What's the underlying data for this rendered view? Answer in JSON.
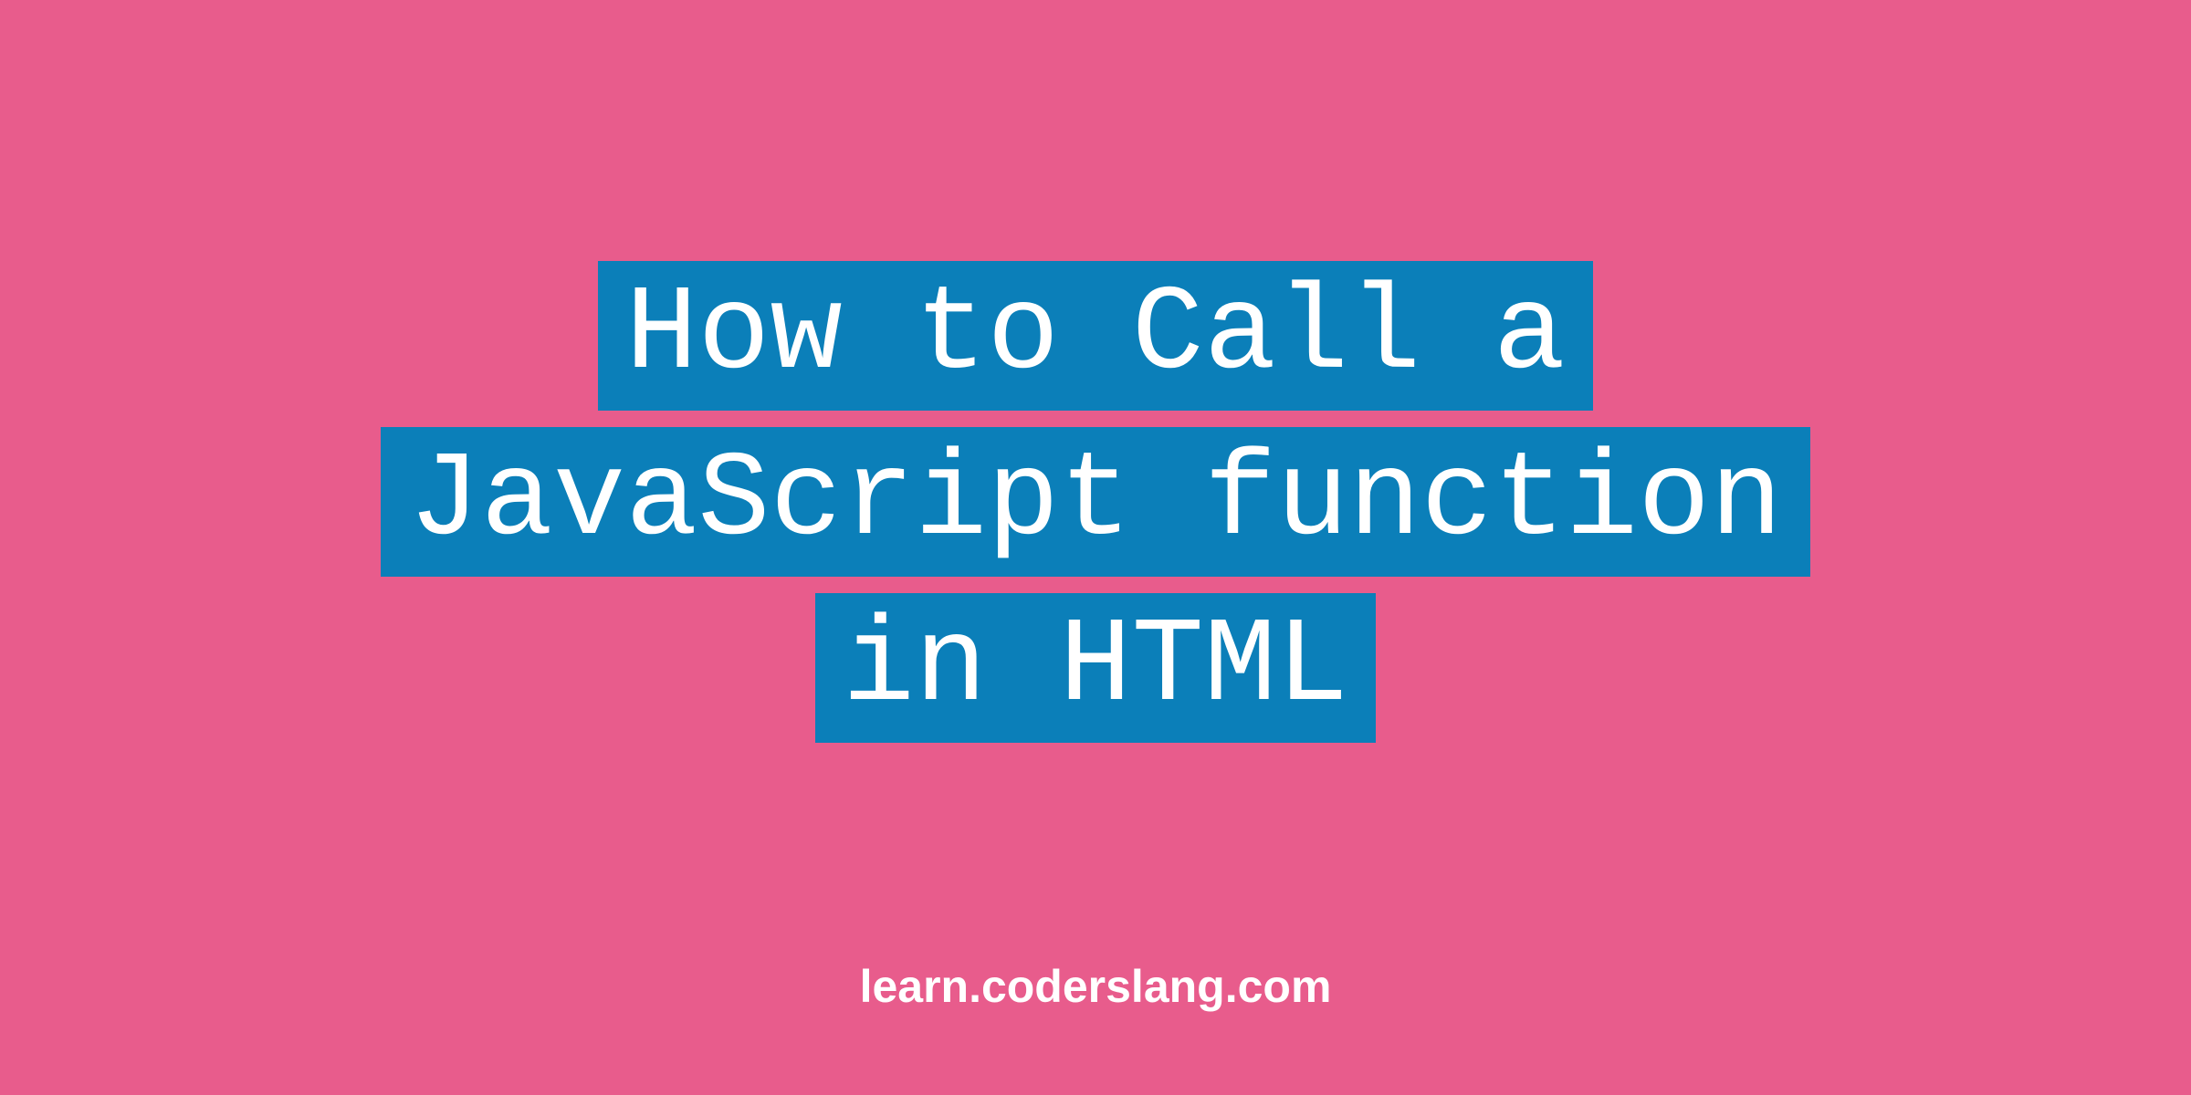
{
  "title": {
    "line1": "How to Call a",
    "line2": "JavaScript function",
    "line3": "in HTML"
  },
  "footer": {
    "text": "learn.coderslang.com"
  },
  "colors": {
    "background": "#e85c8c",
    "highlight": "#0b7fb9",
    "text": "#ffffff"
  }
}
